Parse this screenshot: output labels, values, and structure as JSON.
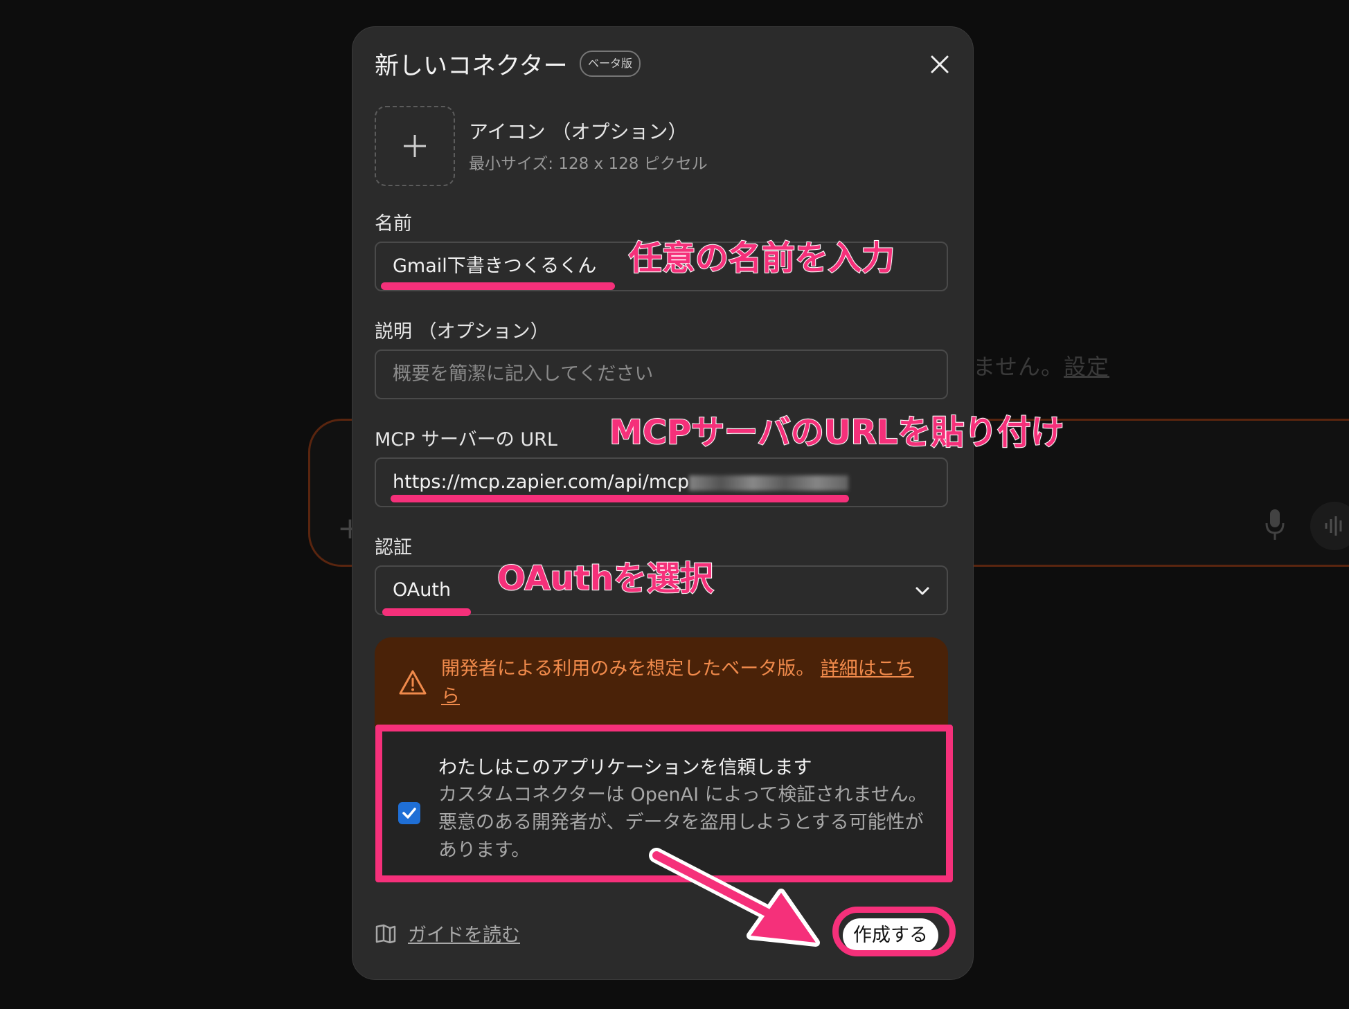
{
  "background": {
    "notice_text": "ません。",
    "notice_link": "設定"
  },
  "modal": {
    "title": "新しいコネクター",
    "beta_badge": "ベータ版",
    "icon": {
      "title": "アイコン （オプション）",
      "subtitle": "最小サイズ: 128 x 128 ピクセル"
    },
    "name": {
      "label": "名前",
      "value": "Gmail下書きつくるくん"
    },
    "description": {
      "label": "説明 （オプション）",
      "placeholder": "概要を簡潔に記入してください"
    },
    "mcp_url": {
      "label": "MCP サーバーの URL",
      "value": "https://mcp.zapier.com/api/mcp"
    },
    "auth": {
      "label": "認証",
      "value": "OAuth"
    },
    "warning": {
      "text": "開発者による利用のみを想定したベータ版。",
      "link": "詳細はこちら"
    },
    "trust": {
      "checked": true,
      "title": "わたしはこのアプリケーションを信頼します",
      "description": "カスタムコネクターは OpenAI によって検証されません。悪意のある開発者が、データを盗用しようとする可能性があります。"
    },
    "guide_link": "ガイドを読む",
    "create_button": "作成する"
  },
  "annotations": {
    "name_hint": "任意の名前を入力",
    "url_hint": "MCPサーバのURLを貼り付け",
    "auth_hint": "OAuthを選択",
    "accent_color": "#f5307a"
  }
}
